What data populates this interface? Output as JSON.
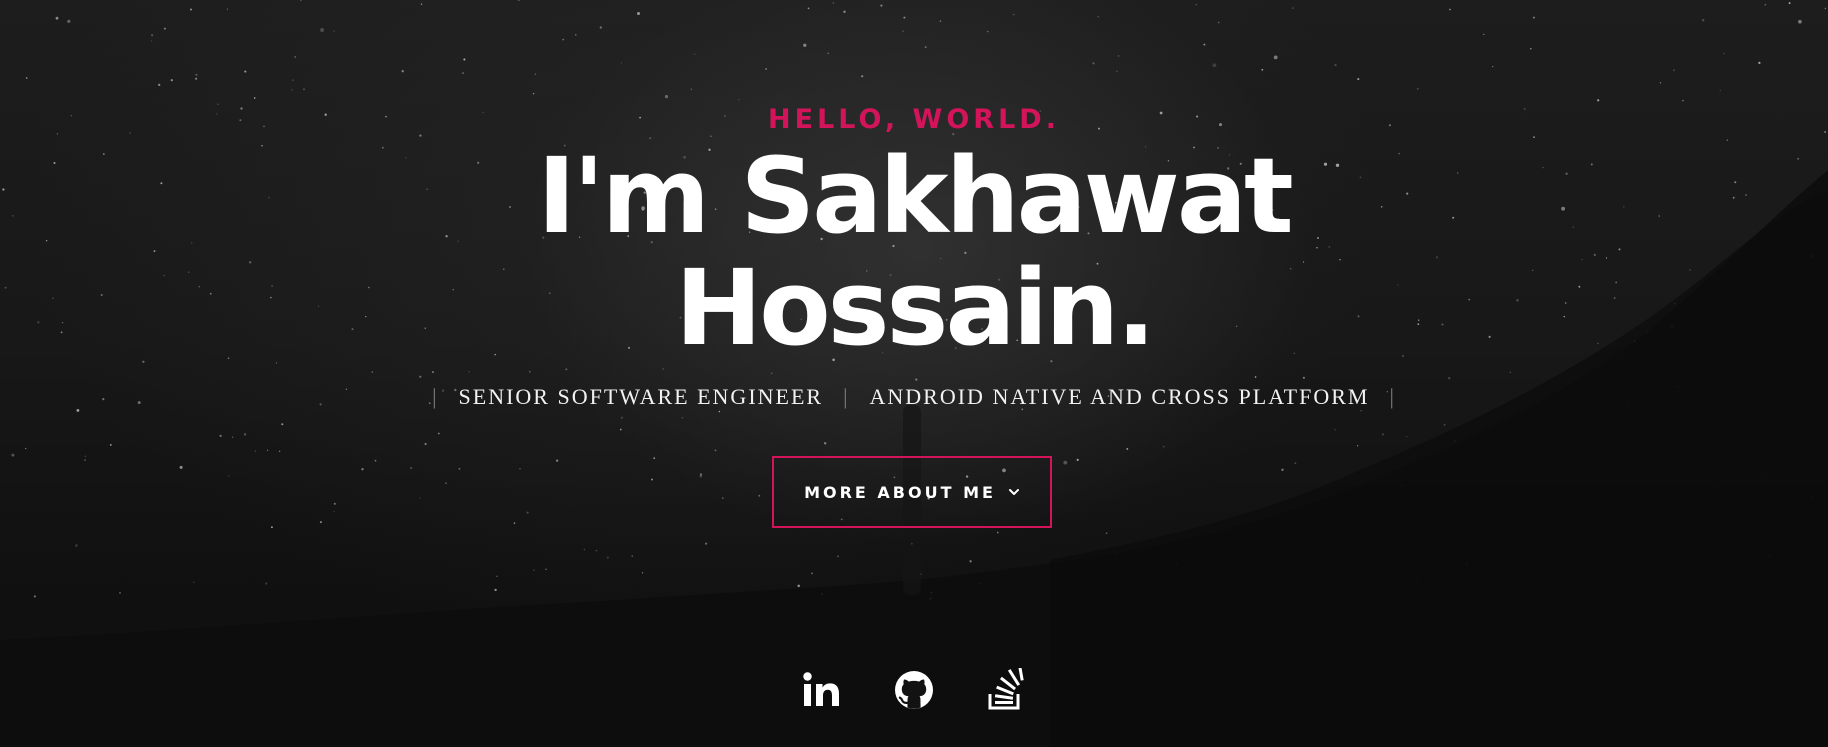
{
  "hero": {
    "kicker": "HELLO, WORLD.",
    "headline_line1": "I'm Sakhawat",
    "headline_line2": "Hossain.",
    "roles": [
      "SENIOR SOFTWARE ENGINEER",
      "ANDROID NATIVE AND CROSS PLATFORM"
    ],
    "role_separator": "|",
    "cta_label": "MORE ABOUT ME",
    "cta_icon": "chevron-down-icon"
  },
  "social": [
    {
      "icon": "linkedin-icon"
    },
    {
      "icon": "github-icon"
    },
    {
      "icon": "stackoverflow-icon"
    }
  ],
  "colors": {
    "accent": "#d4145a",
    "background": "#121212",
    "text": "#ffffff",
    "separator": "#7c7c7c"
  }
}
